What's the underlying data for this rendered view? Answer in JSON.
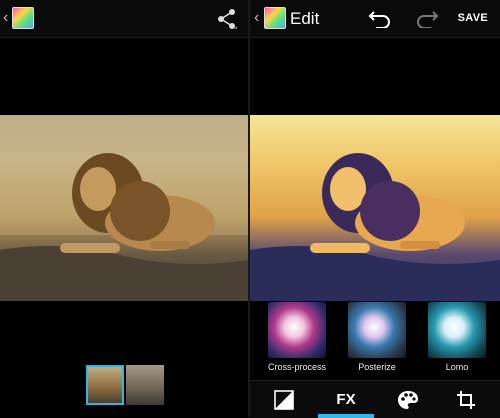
{
  "left_pane": {
    "thumbnails": [
      "lion-photo",
      "zebra-photo"
    ]
  },
  "right_pane": {
    "title": "Edit",
    "save_label": "SAVE",
    "fx_filters": [
      {
        "label": "Cross-process"
      },
      {
        "label": "Posterize"
      },
      {
        "label": "Lomo"
      }
    ],
    "tabs": [
      {
        "name": "exposure",
        "label": ""
      },
      {
        "name": "fx",
        "label": "FX"
      },
      {
        "name": "color",
        "label": ""
      },
      {
        "name": "crop",
        "label": ""
      }
    ]
  },
  "colors": {
    "accent": "#33b5e5",
    "bar": "#0a0a0a"
  },
  "icons": [
    "chevron-left-icon",
    "gallery-app-icon",
    "share-icon",
    "undo-icon",
    "redo-icon",
    "brightness-icon",
    "palette-icon",
    "crop-icon"
  ]
}
